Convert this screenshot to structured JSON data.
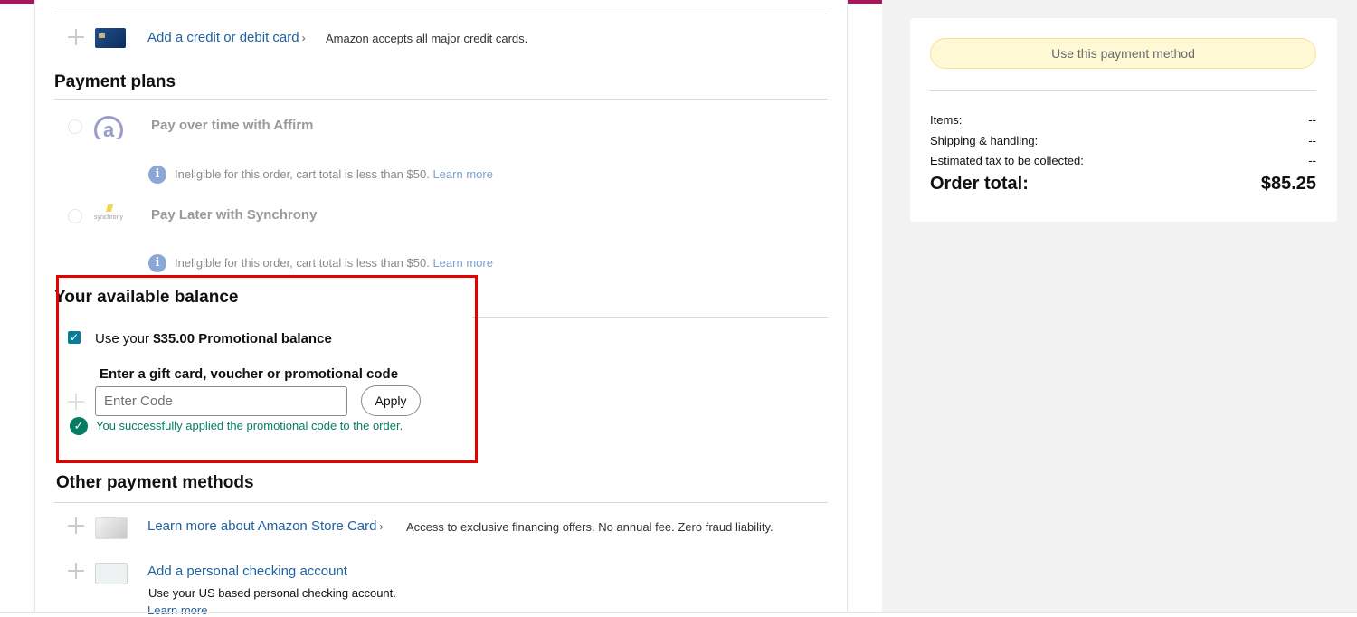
{
  "colors": {
    "accent_bar": "#a3195b",
    "link": "#2162a1",
    "success": "#067d62",
    "highlight": "#e60000"
  },
  "credit_card": {
    "link": "Add a credit or debit card",
    "note": "Amazon accepts all major credit cards."
  },
  "payment_plans": {
    "heading": "Payment plans",
    "affirm": {
      "title": "Pay over time with Affirm",
      "logo_text": "a",
      "ineligible": "Ineligible for this order, cart total is less than $50.",
      "learn_more": "Learn more"
    },
    "synchrony": {
      "title": "Pay Later with Synchrony",
      "logo_text": "synchrony",
      "ineligible": "Ineligible for this order, cart total is less than $50.",
      "learn_more": "Learn more"
    }
  },
  "balance": {
    "heading": "Your available balance",
    "use_prefix": "Use your",
    "use_amount": "$35.00 Promotional balance",
    "checked": true,
    "code_label": "Enter a gift card, voucher or promotional code",
    "code_placeholder": "Enter Code",
    "apply_label": "Apply",
    "success_msg": "You successfully applied the promotional code to the order."
  },
  "other_methods": {
    "heading": "Other payment methods",
    "store_card_link": "Learn more about Amazon Store Card",
    "store_card_note": "Access to exclusive financing offers. No annual fee. Zero fraud liability.",
    "checking_link": "Add a personal checking account",
    "checking_note": "Use your US based personal checking account.",
    "checking_more": "Learn more"
  },
  "summary": {
    "button": "Use this payment method",
    "items_label": "Items:",
    "items_value": "--",
    "shipping_label": "Shipping & handling:",
    "shipping_value": "--",
    "tax_label": "Estimated tax to be collected:",
    "tax_value": "--",
    "total_label": "Order total:",
    "total_value": "$85.25"
  }
}
